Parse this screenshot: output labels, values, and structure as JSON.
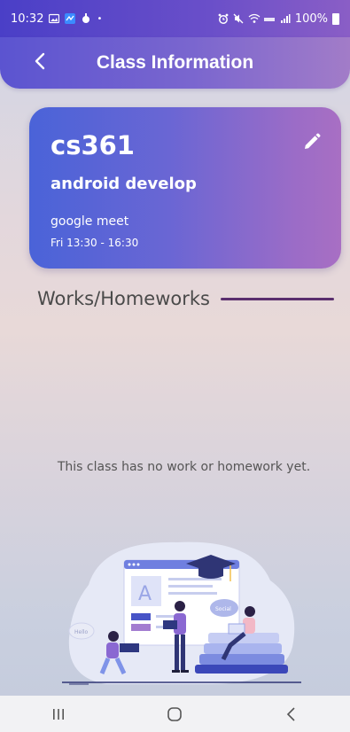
{
  "status_bar": {
    "time": "10:32",
    "battery": "100%"
  },
  "app_bar": {
    "title": "Class Information",
    "back_icon": "chevron-left-icon"
  },
  "class_card": {
    "code": "cs361",
    "name": "android develop",
    "platform": "google meet",
    "schedule": "Fri 13:30 - 16:30",
    "edit_icon": "pencil-icon"
  },
  "works_section": {
    "title": "Works/Homeworks",
    "empty_message": "This class has no work or homework yet."
  },
  "nav_bar": {
    "recents_icon": "recents-icon",
    "home_icon": "home-icon",
    "back_icon": "back-icon"
  },
  "colors": {
    "status_bar": "#4a3fc7",
    "app_bar_start": "#5b54d0",
    "app_bar_end": "#a27cc8",
    "card_start": "#4a63d8",
    "card_end": "#a86fc3",
    "section_line": "#5a2e6e"
  }
}
